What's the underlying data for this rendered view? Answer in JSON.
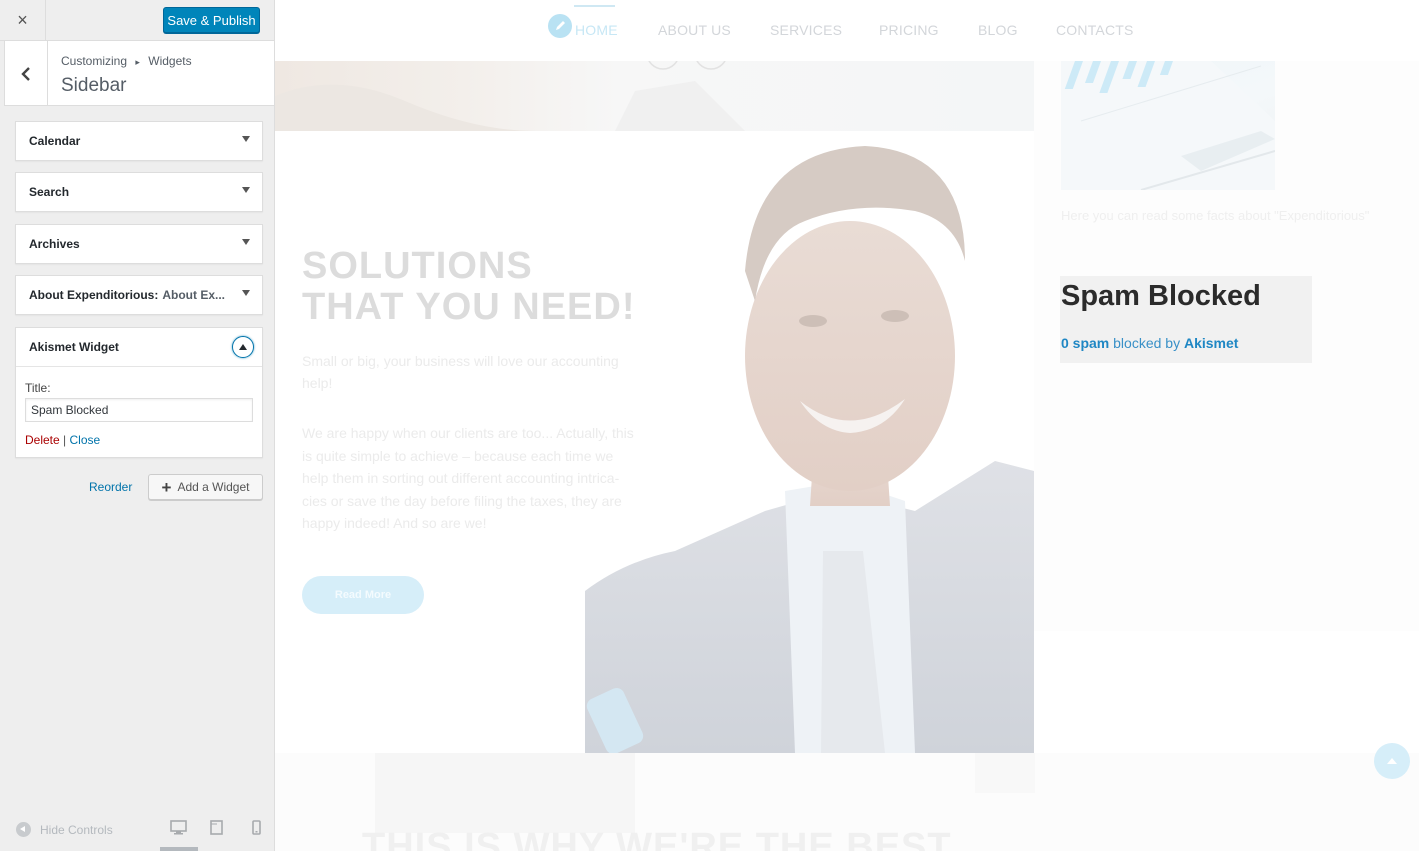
{
  "customizer": {
    "close_label": "×",
    "save_label": "Save & Publish",
    "breadcrumb": {
      "root": "Customizing",
      "separator": "▸",
      "current": "Widgets"
    },
    "section_title": "Sidebar",
    "widgets": [
      {
        "title": "Calendar",
        "in_widget_title": ""
      },
      {
        "title": "Search",
        "in_widget_title": ""
      },
      {
        "title": "Archives",
        "in_widget_title": ""
      },
      {
        "title": "About Expenditorious:",
        "in_widget_title": "About Ex..."
      },
      {
        "title": "Akismet Widget",
        "in_widget_title": ""
      }
    ],
    "open_widget": {
      "field_label": "Title:",
      "field_value": "Spam Blocked",
      "delete_label": "Delete",
      "separator": "|",
      "close_label": "Close"
    },
    "reorder_label": "Reorder",
    "add_widget_label": "Add a Widget",
    "hide_controls_label": "Hide Controls",
    "devices": [
      "desktop-icon",
      "tablet-icon",
      "mobile-icon"
    ],
    "active_device": "desktop"
  },
  "preview": {
    "nav": [
      "HOME",
      "ABOUT US",
      "SERVICES",
      "PRICING",
      "BLOG",
      "CONTACTS"
    ],
    "active_nav": "HOME",
    "hero": {
      "title_line1": "SOLUTIONS",
      "title_line2": "THAT YOU NEED!",
      "paragraph1": "Small or big, your business will love our accounting help!",
      "paragraph2": "We are happy when our clients are too... Actually, this is quite simple to achieve – because each time we help them in sorting out different accounting intrica-cies or save the day before filing the taxes, they are happy indeed! And so are we!",
      "button_label": "Read More"
    },
    "sidebar": {
      "caption": "Here you can read some facts about \"Expenditorious\"",
      "akismet_title": "Spam Blocked",
      "akismet_count": "0 spam",
      "akismet_mid": " blocked by ",
      "akismet_brand": "Akismet"
    },
    "bottom_heading": "THIS IS WHY WE'RE THE BEST"
  },
  "colors": {
    "accent": "#0085ba",
    "link": "#0073aa",
    "delete": "#aa0000",
    "akismet_link": "#1f87c4"
  }
}
